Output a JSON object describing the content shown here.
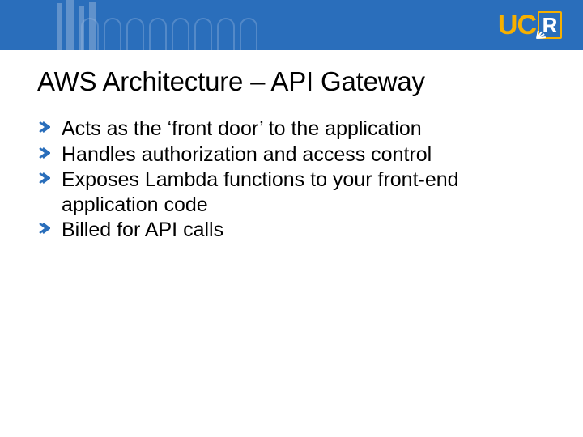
{
  "logo": {
    "uc": "UC",
    "r": "R"
  },
  "title": "AWS Architecture – API Gateway",
  "bullets": [
    "Acts as the ‘front door’ to the application",
    "Handles authorization and access control",
    "Exposes Lambda functions to your front-end application code",
    "Billed for API calls"
  ]
}
